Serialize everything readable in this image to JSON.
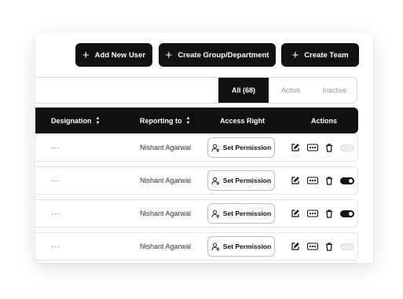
{
  "toolbar": {
    "add_user": "Add New User",
    "create_group": "Create Group/Department",
    "create_team": "Create Team"
  },
  "filters": {
    "all": "All (68)",
    "active": "Active",
    "inactive": "Inactive",
    "selected": "All (68)"
  },
  "table": {
    "headers": {
      "designation": "Designation",
      "reporting_to": "Reporting to",
      "access_right": "Access Right",
      "actions": "Actions"
    },
    "rows": [
      {
        "designation": "---",
        "reporting_to": "Nishant Agarwal",
        "permission_label": "Set Permission",
        "status_on": false
      },
      {
        "designation": "---",
        "reporting_to": "Nishant Agarwal",
        "permission_label": "Set Permission",
        "status_on": true
      },
      {
        "designation": "---",
        "reporting_to": "Nishant Agarwal",
        "permission_label": "Set Permission",
        "status_on": true
      },
      {
        "designation": "---",
        "reporting_to": "Nishant Agarwal",
        "permission_label": "Set Permission",
        "status_on": false
      }
    ]
  },
  "icons": {
    "toolbar_button": "plus-icon",
    "sort": "sort-icon",
    "permission": "user-key-icon",
    "row_actions": [
      "edit-icon",
      "id-card-icon",
      "trash-icon",
      "status-toggle"
    ]
  },
  "colors": {
    "primary": "#111111",
    "muted_text": "#9a9a9a",
    "border": "#dedede"
  }
}
